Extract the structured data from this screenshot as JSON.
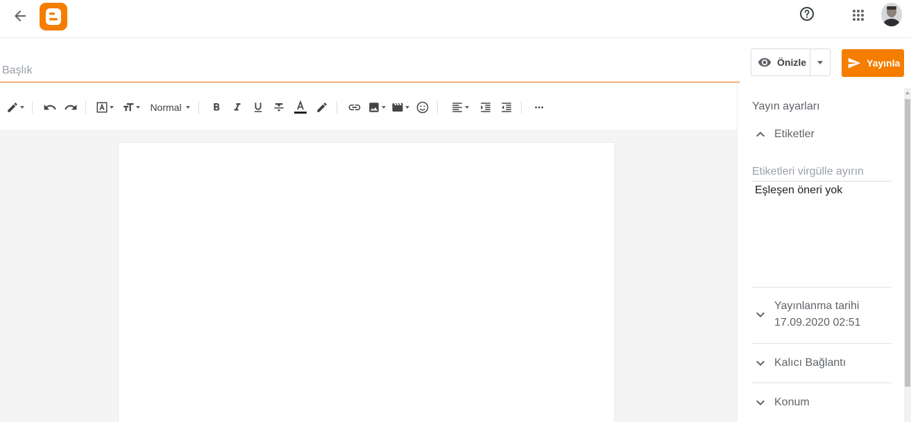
{
  "header": {
    "back_icon": "arrow-back-icon",
    "logo_icon": "blogger-logo-icon",
    "help_icon": "help-circle-icon",
    "apps_icon": "apps-grid-icon",
    "accent_color": "#f57d00"
  },
  "post": {
    "title_placeholder": "Başlık",
    "title_value": ""
  },
  "actions": {
    "preview_label": "Önizle",
    "publish_label": "Yayınla"
  },
  "toolbar": {
    "format_label": "Normal"
  },
  "sidebar": {
    "heading": "Yayın ayarları",
    "labels": {
      "title": "Etiketler",
      "input_placeholder": "Etiketleri virgülle ayırın",
      "no_suggestions": "Eşleşen öneri yok"
    },
    "publish_date": {
      "title": "Yayınlanma tarihi",
      "value": "17.09.2020 02:51"
    },
    "permalink": {
      "title": "Kalıcı Bağlantı"
    },
    "location": {
      "title": "Konum"
    }
  }
}
